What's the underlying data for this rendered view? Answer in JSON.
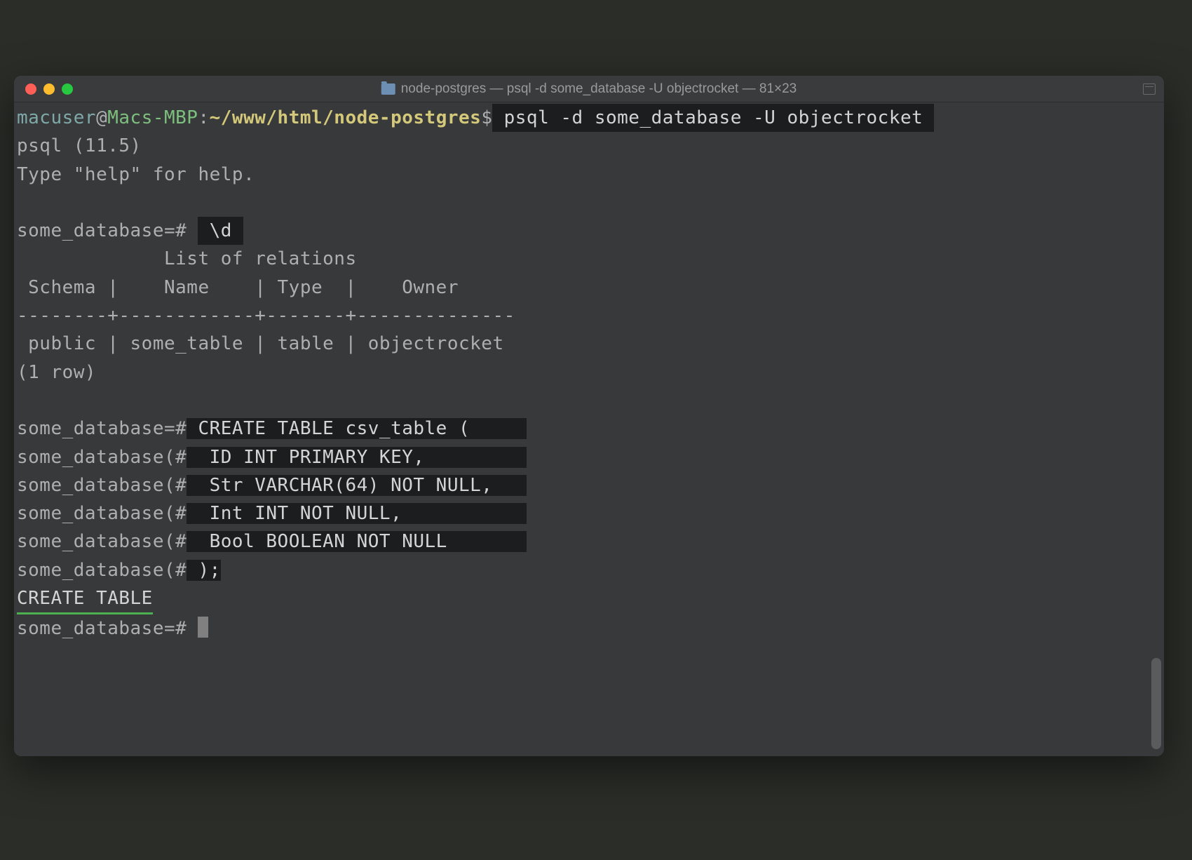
{
  "titlebar": {
    "title": "node-postgres — psql -d some_database -U objectrocket — 81×23"
  },
  "prompt": {
    "user": "macuser",
    "at": "@",
    "host": "Macs-MBP",
    "colon": ":",
    "path": "~/www/html/node-postgres",
    "dollar": "$"
  },
  "cmd1": " psql -d some_database -U objectrocket ",
  "psql_version": "psql (11.5)",
  "help_hint": "Type \"help\" for help.",
  "psql_prompt1": "some_database=# ",
  "cmd2": " \\d ",
  "relations_title": "             List of relations",
  "relations_header": " Schema |    Name    | Type  |    Owner",
  "relations_divider": "--------+------------+-------+--------------",
  "relations_row": " public | some_table | table | objectrocket",
  "row_count": "(1 row)",
  "psql_prompt2": "some_database=#",
  "psql_prompt_cont": "some_database(#",
  "create_lines": {
    "l1": " CREATE TABLE csv_table (     ",
    "l2": "  ID INT PRIMARY KEY,         ",
    "l3": "  Str VARCHAR(64) NOT NULL,   ",
    "l4": "  Int INT NOT NULL,           ",
    "l5": "  Bool BOOLEAN NOT NULL       ",
    "l6": " );"
  },
  "create_result": "CREATE TABLE",
  "final_prompt": "some_database=# "
}
